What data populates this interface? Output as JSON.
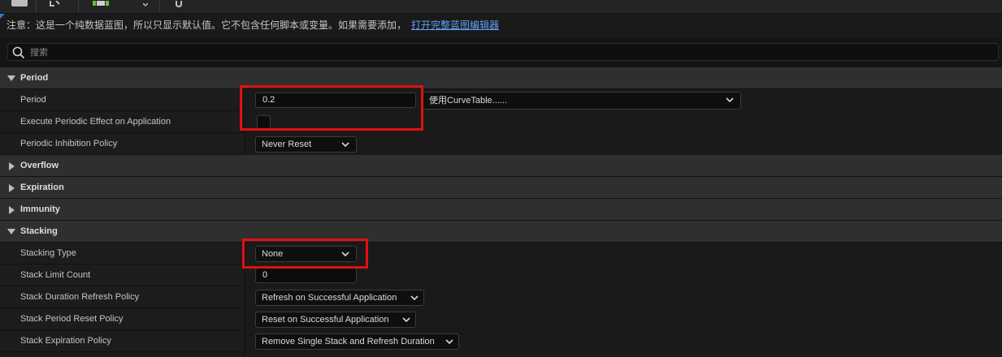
{
  "notice": {
    "text": "注意：这是一个纯数据蓝图，所以只显示默认值。它不包含任何脚本或变量。如果需要添加，",
    "link": "打开完整蓝图编辑器"
  },
  "search": {
    "placeholder": "搜索"
  },
  "categories": {
    "period": "Period",
    "overflow": "Overflow",
    "expiration": "Expiration",
    "immunity": "Immunity",
    "stacking": "Stacking"
  },
  "period": {
    "period_label": "Period",
    "period_value": "0.2",
    "curve_table": "使用CurveTable......",
    "execute_label": "Execute Periodic Effect on Application",
    "execute_checked": false,
    "inhibition_label": "Periodic Inhibition Policy",
    "inhibition_value": "Never Reset"
  },
  "stacking": {
    "type_label": "Stacking Type",
    "type_value": "None",
    "limit_label": "Stack Limit Count",
    "limit_value": "0",
    "duration_label": "Stack Duration Refresh Policy",
    "duration_value": "Refresh on Successful Application",
    "period_reset_label": "Stack Period Reset Policy",
    "period_reset_value": "Reset on Successful Application",
    "expiration_label": "Stack Expiration Policy",
    "expiration_value": "Remove Single Stack and Refresh Duration"
  },
  "colors": {
    "highlight": "#e01010",
    "link": "#5fa3f5",
    "accent": "#2e7bd8"
  }
}
